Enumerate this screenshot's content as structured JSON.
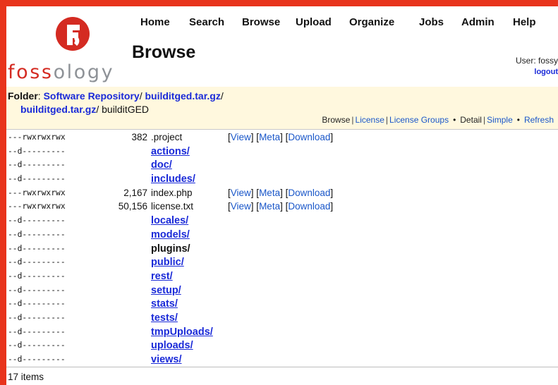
{
  "logo": {
    "text_red": "foss",
    "text_gray": "ology"
  },
  "page_title": "Browse",
  "nav": {
    "items": [
      "Home",
      "Search",
      "Browse",
      "Upload",
      "Organize",
      "Jobs",
      "Admin",
      "Help"
    ]
  },
  "user": {
    "label": "User: fossy",
    "logout": "logout"
  },
  "folder": {
    "label": "Folder",
    "path1": "Software Repository",
    "path2": "builditged.tar.gz",
    "path3": "builditged.tar.gz",
    "current": "builditGED",
    "sep": "/"
  },
  "views": {
    "browse": "Browse",
    "license": "License",
    "license_groups": "License Groups",
    "detail": "Detail",
    "simple": "Simple",
    "refresh": "Refresh"
  },
  "actions": {
    "view": "View",
    "meta": "Meta",
    "download": "Download"
  },
  "files": [
    {
      "perm": "---rwxrwxrwx",
      "size": "382",
      "name": ".project",
      "type": "file"
    },
    {
      "perm": "--d---------",
      "size": "",
      "name": "actions/",
      "type": "dir"
    },
    {
      "perm": "--d---------",
      "size": "",
      "name": "doc/",
      "type": "dir"
    },
    {
      "perm": "--d---------",
      "size": "",
      "name": "includes/",
      "type": "dir"
    },
    {
      "perm": "---rwxrwxrwx",
      "size": "2,167",
      "name": "index.php",
      "type": "file"
    },
    {
      "perm": "---rwxrwxrwx",
      "size": "50,156",
      "name": "license.txt",
      "type": "file"
    },
    {
      "perm": "--d---------",
      "size": "",
      "name": "locales/",
      "type": "dir"
    },
    {
      "perm": "--d---------",
      "size": "",
      "name": "models/",
      "type": "dir"
    },
    {
      "perm": "--d---------",
      "size": "",
      "name": "plugins/",
      "type": "dir-plain"
    },
    {
      "perm": "--d---------",
      "size": "",
      "name": "public/",
      "type": "dir"
    },
    {
      "perm": "--d---------",
      "size": "",
      "name": "rest/",
      "type": "dir"
    },
    {
      "perm": "--d---------",
      "size": "",
      "name": "setup/",
      "type": "dir"
    },
    {
      "perm": "--d---------",
      "size": "",
      "name": "stats/",
      "type": "dir"
    },
    {
      "perm": "--d---------",
      "size": "",
      "name": "tests/",
      "type": "dir"
    },
    {
      "perm": "--d---------",
      "size": "",
      "name": "tmpUploads/",
      "type": "dir"
    },
    {
      "perm": "--d---------",
      "size": "",
      "name": "uploads/",
      "type": "dir"
    },
    {
      "perm": "--d---------",
      "size": "",
      "name": "views/",
      "type": "dir"
    }
  ],
  "footer": {
    "count": "17 items"
  },
  "colors": {
    "border": "#e8341c",
    "link": "#1a2ad8",
    "folder_bg": "#fff8de",
    "logo_red": "#d42b22"
  }
}
